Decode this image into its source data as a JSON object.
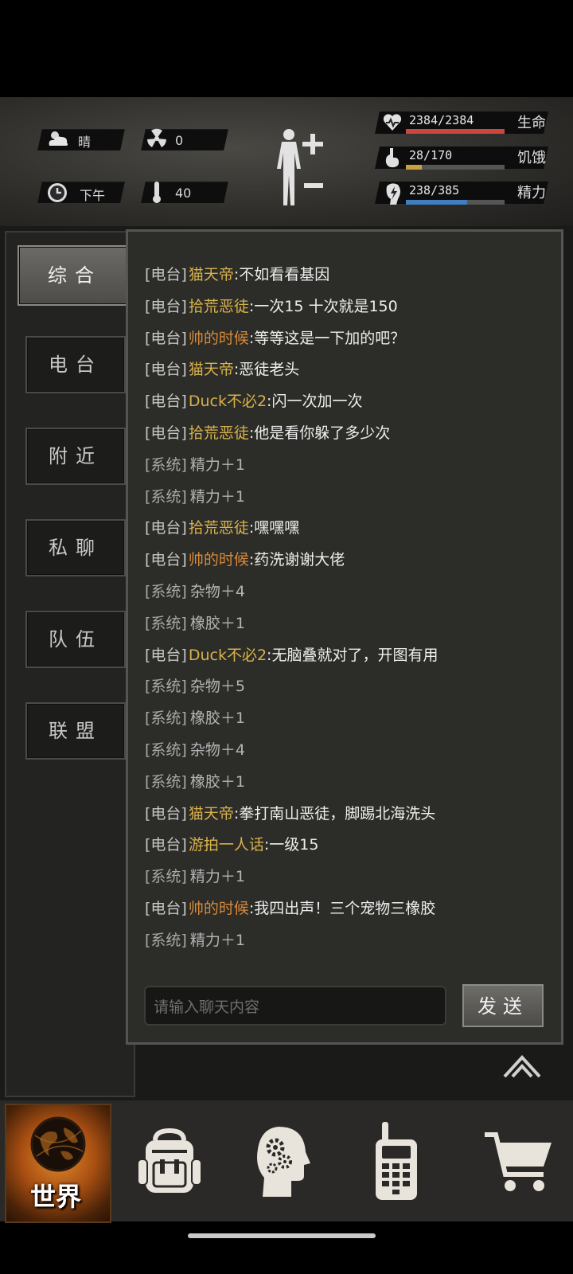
{
  "status": {
    "weather": "晴",
    "radiation": "0",
    "time": "下午",
    "temperature": "40",
    "health": {
      "text": "2384/2384",
      "label": "生命",
      "fraction": 1.0,
      "color": "#c9473c"
    },
    "hunger": {
      "text": "28/170",
      "label": "饥饿",
      "fraction": 0.165,
      "color": "#c9a13c"
    },
    "stamina": {
      "text": "238/385",
      "label": "精力",
      "fraction": 0.618,
      "color": "#3f7fc0"
    },
    "icons": [
      "weather-icon",
      "radiation-icon",
      "clock-icon",
      "thermometer-icon",
      "body-figure-icon",
      "plus-icon",
      "minus-icon",
      "heart-icon",
      "stomach-icon",
      "energy-icon"
    ]
  },
  "tabs": [
    {
      "label": "综合",
      "active": true
    },
    {
      "label": "电台",
      "active": false
    },
    {
      "label": "附近",
      "active": false
    },
    {
      "label": "私聊",
      "active": false
    },
    {
      "label": "队伍",
      "active": false
    },
    {
      "label": "联盟",
      "active": false
    }
  ],
  "messages": [
    {
      "tag": "[电台]",
      "name": "猫天帝",
      "text": ":不如看看基因",
      "color": "#d8b24a"
    },
    {
      "tag": "[电台]",
      "name": "拾荒恶徒",
      "text": ":一次15 十次就是150",
      "color": "#d8b24a"
    },
    {
      "tag": "[电台]",
      "name": "帅的时候",
      "text": ":等等这是一下加的吧？",
      "color": "#d88a3a"
    },
    {
      "tag": "[电台]",
      "name": "猫天帝",
      "text": ":恶徒老头",
      "color": "#d8b24a"
    },
    {
      "tag": "[电台]",
      "name": "Duck不必2",
      "text": ":闪一次加一次",
      "color": "#d8b24a"
    },
    {
      "tag": "[电台]",
      "name": "拾荒恶徒",
      "text": ":他是看你躲了多少次",
      "color": "#d8b24a"
    },
    {
      "tag": "[系统]",
      "name": "",
      "text": "精力＋1",
      "color": ""
    },
    {
      "tag": "[系统]",
      "name": "",
      "text": "精力＋1",
      "color": ""
    },
    {
      "tag": "[电台]",
      "name": "拾荒恶徒",
      "text": ":嘿嘿嘿",
      "color": "#d8b24a"
    },
    {
      "tag": "[电台]",
      "name": "帅的时候",
      "text": ":药洗谢谢大佬",
      "color": "#d88a3a"
    },
    {
      "tag": "[系统]",
      "name": "",
      "text": "杂物＋4",
      "color": ""
    },
    {
      "tag": "[系统]",
      "name": "",
      "text": "橡胶＋1",
      "color": ""
    },
    {
      "tag": "[电台]",
      "name": "Duck不必2",
      "text": ":无脑叠就对了，开图有用",
      "color": "#d8b24a"
    },
    {
      "tag": "[系统]",
      "name": "",
      "text": "杂物＋5",
      "color": ""
    },
    {
      "tag": "[系统]",
      "name": "",
      "text": "橡胶＋1",
      "color": ""
    },
    {
      "tag": "[系统]",
      "name": "",
      "text": "杂物＋4",
      "color": ""
    },
    {
      "tag": "[系统]",
      "name": "",
      "text": "橡胶＋1",
      "color": ""
    },
    {
      "tag": "[电台]",
      "name": "猫天帝",
      "text": ":拳打南山恶徒，脚踢北海洗头",
      "color": "#d8b24a"
    },
    {
      "tag": "[电台]",
      "name": "游拍一人话",
      "text": ":一级15",
      "color": "#d8b24a"
    },
    {
      "tag": "[系统]",
      "name": "",
      "text": "精力＋1",
      "color": ""
    },
    {
      "tag": "[电台]",
      "name": "帅的时候",
      "text": ":我四出声！三个宠物三橡胶",
      "color": "#d88a3a"
    },
    {
      "tag": "[系统]",
      "name": "",
      "text": "精力＋1",
      "color": ""
    }
  ],
  "input": {
    "placeholder": "请输入聊天内容"
  },
  "send_label": "发送",
  "nav": [
    {
      "label": "世界",
      "icon": "globe-icon",
      "active": true
    },
    {
      "label": "",
      "icon": "backpack-icon",
      "active": false
    },
    {
      "label": "",
      "icon": "head-gears-icon",
      "active": false
    },
    {
      "label": "",
      "icon": "walkie-talkie-icon",
      "active": false
    },
    {
      "label": "",
      "icon": "cart-icon",
      "active": false
    }
  ]
}
